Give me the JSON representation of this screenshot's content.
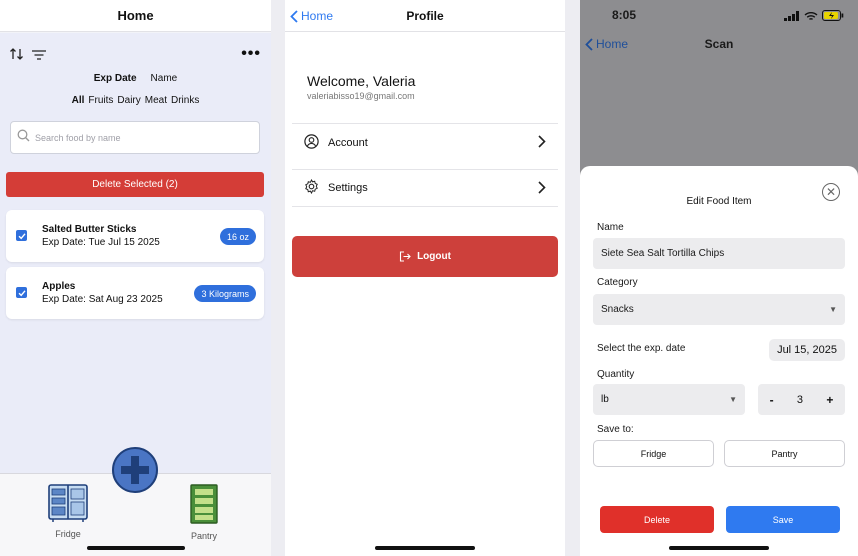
{
  "home": {
    "title": "Home",
    "sort_options": [
      "Exp Date",
      "Name"
    ],
    "categories": [
      "All",
      "Fruits",
      "Dairy",
      "Meat",
      "Drinks"
    ],
    "search_placeholder": "Search food by name",
    "delete_selected_label": "Delete Selected (2)",
    "items": [
      {
        "name": "Salted Butter Sticks",
        "exp": "Exp Date: Tue Jul 15 2025",
        "qty": "16 oz",
        "checked": true
      },
      {
        "name": "Apples",
        "exp": "Exp Date: Sat Aug 23 2025",
        "qty": "3 Kilograms",
        "checked": true
      }
    ],
    "tabs": {
      "fridge": "Fridge",
      "pantry": "Pantry"
    }
  },
  "profile": {
    "back_label": "Home",
    "title": "Profile",
    "welcome": "Welcome, Valeria",
    "email": "valeriabisso19@gmail.com",
    "menu": {
      "account": "Account",
      "settings": "Settings"
    },
    "logout_label": "Logout"
  },
  "scan": {
    "time": "8:05",
    "back_label": "Home",
    "title": "Scan",
    "sheet": {
      "title": "Edit Food Item",
      "name_label": "Name",
      "name_value": "Siete Sea Salt Tortilla Chips",
      "category_label": "Category",
      "category_value": "Snacks",
      "date_label": "Select the exp. date",
      "date_value": "Jul 15, 2025",
      "quantity_label": "Quantity",
      "unit_value": "lb",
      "quantity_value": "3",
      "minus": "-",
      "plus": "+",
      "save_to_label": "Save to:",
      "save_to_fridge": "Fridge",
      "save_to_pantry": "Pantry",
      "delete_label": "Delete",
      "save_label": "Save"
    }
  },
  "colors": {
    "accent_blue": "#2f7af0",
    "danger_red": "#d43d37",
    "home_bg": "#eaecf8"
  }
}
